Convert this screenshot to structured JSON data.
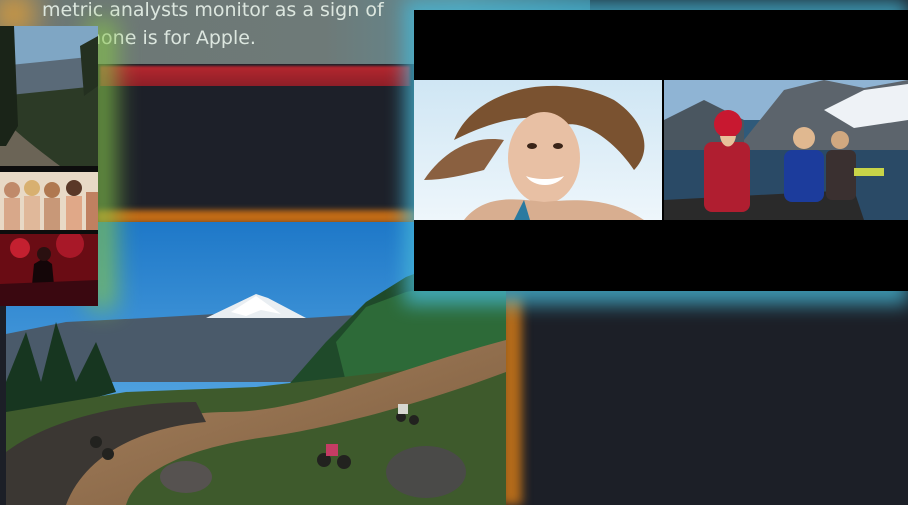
{
  "caption": {
    "line1": "metric analysts monitor as a sign of",
    "line1_tail": "",
    "line2": "hone is for Apple."
  },
  "preview": {
    "left_scene": "woman-smiling-wind-hair",
    "right_scene": "people-in-boat-mountains"
  },
  "main_video": {
    "scene": "mountain-bikers-trail-volcano"
  },
  "thumbnails": [
    {
      "scene": "forest-overlook"
    },
    {
      "scene": "group-of-women"
    },
    {
      "scene": "red-stage-concert"
    }
  ],
  "colors": {
    "background": "#1c1f27",
    "accent_red": "#b4272f",
    "accent_orange": "#c06a16",
    "glow_cyan": "#46b9d8",
    "glow_green": "#86c64a"
  }
}
